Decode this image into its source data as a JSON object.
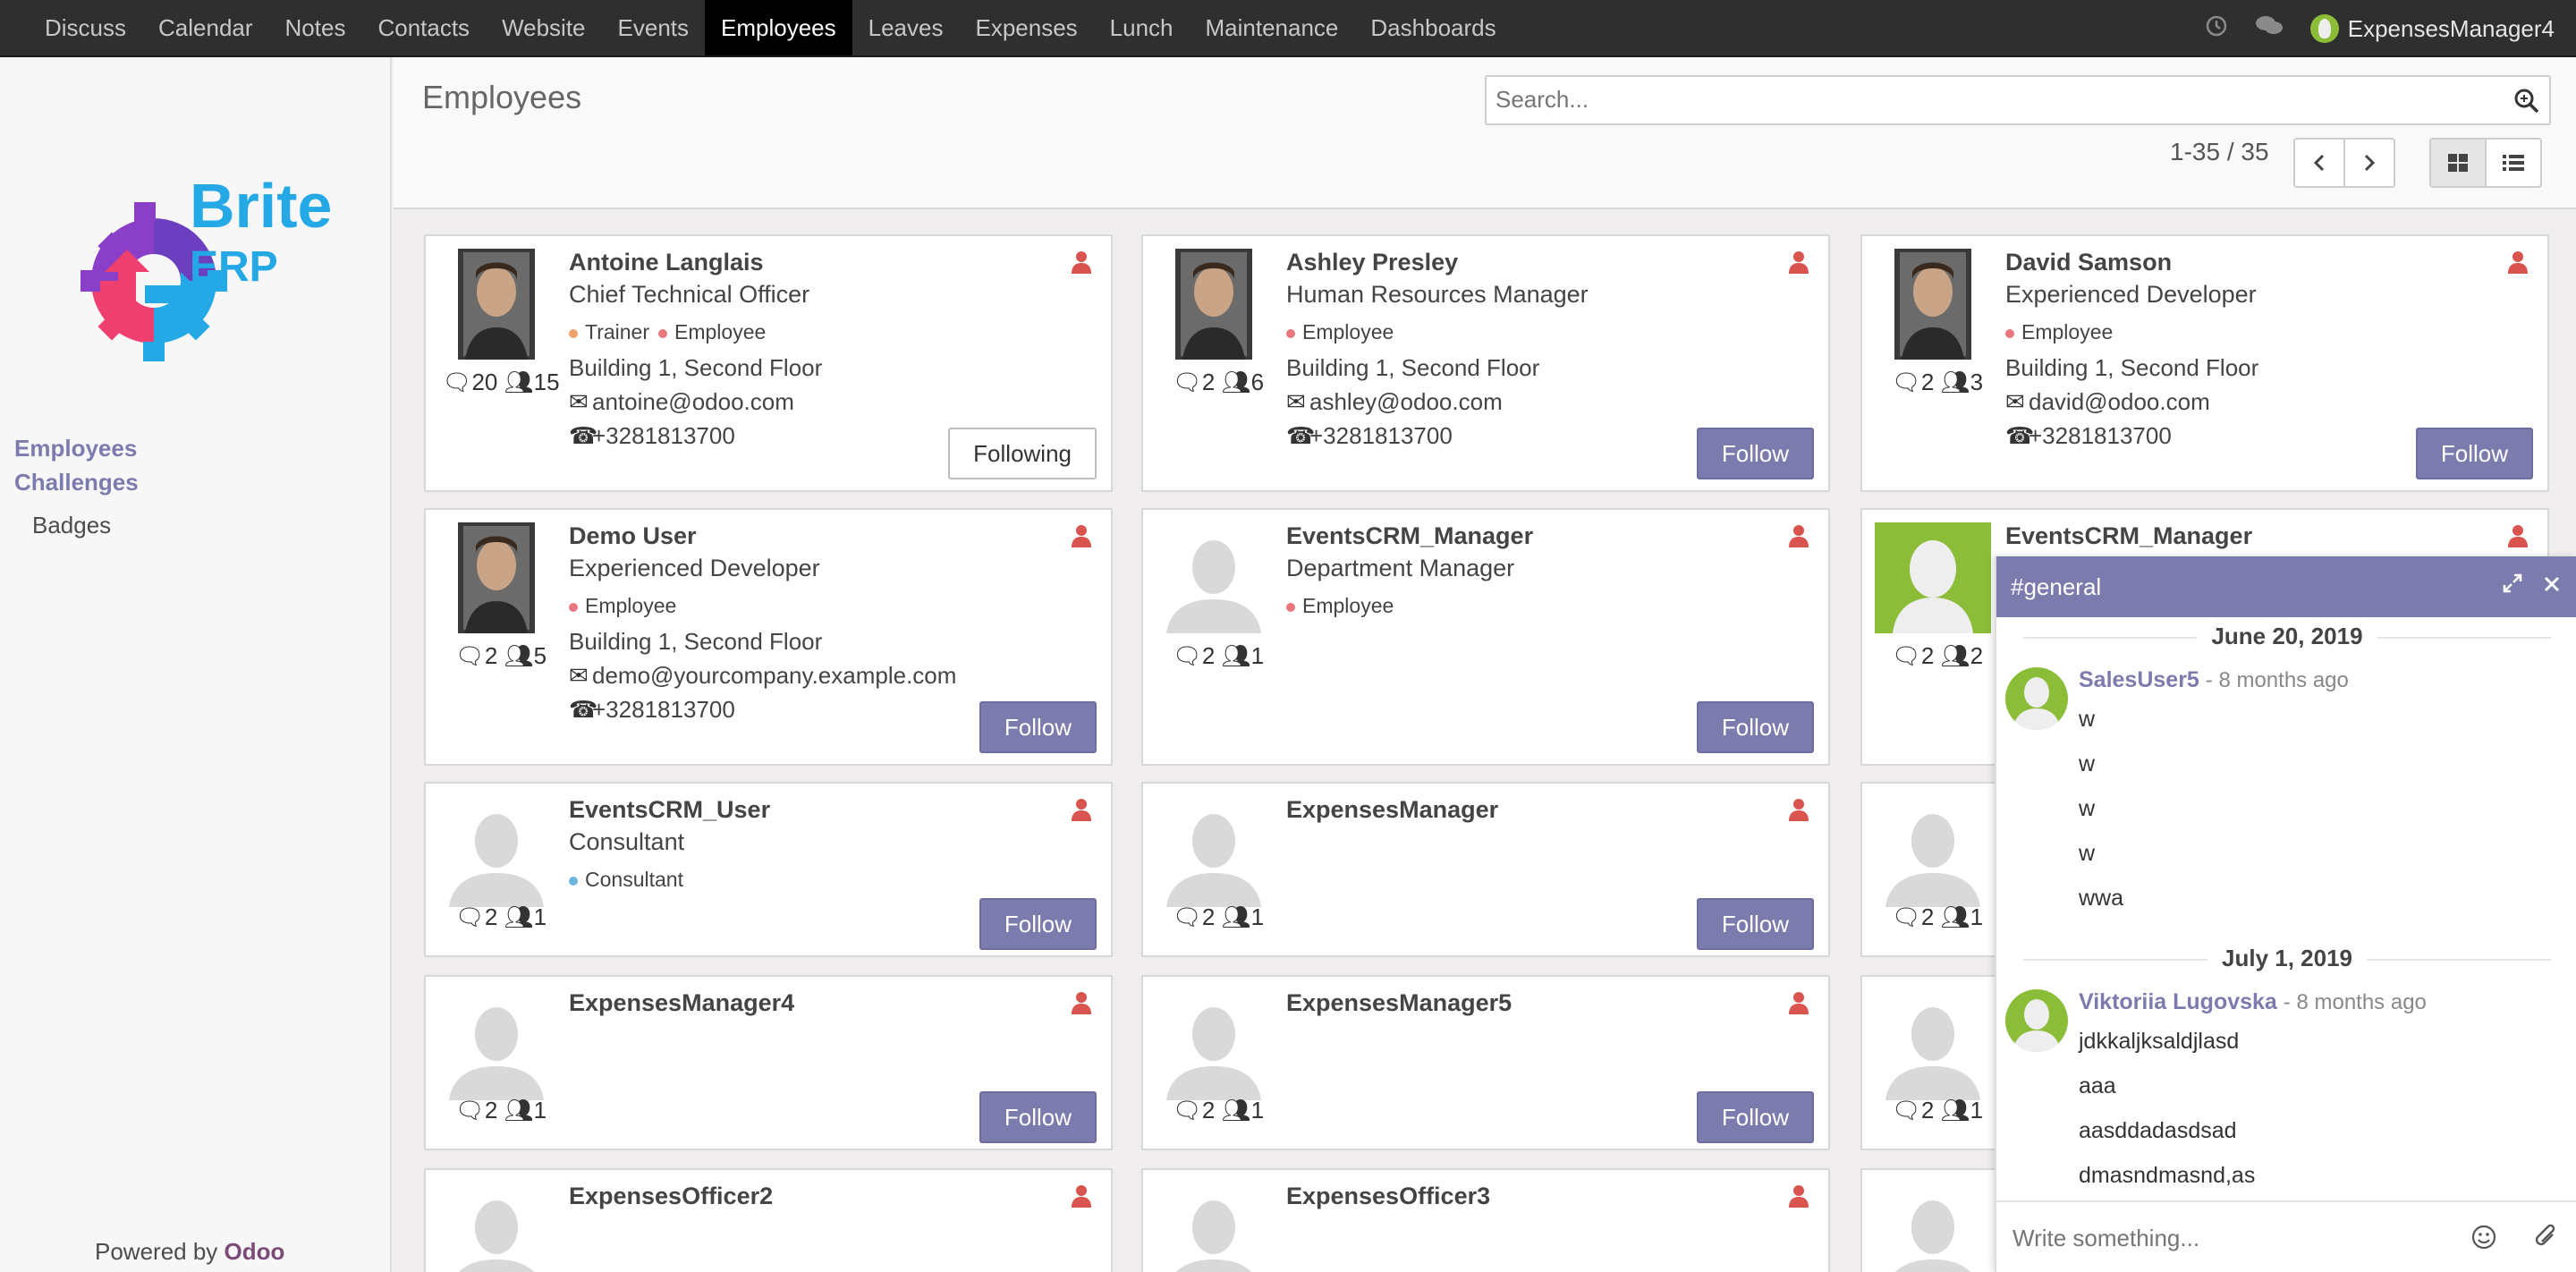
{
  "topbar": {
    "menu": [
      {
        "label": "Discuss",
        "active": false
      },
      {
        "label": "Calendar",
        "active": false
      },
      {
        "label": "Notes",
        "active": false
      },
      {
        "label": "Contacts",
        "active": false
      },
      {
        "label": "Website",
        "active": false
      },
      {
        "label": "Events",
        "active": false
      },
      {
        "label": "Employees",
        "active": true
      },
      {
        "label": "Leaves",
        "active": false
      },
      {
        "label": "Expenses",
        "active": false
      },
      {
        "label": "Lunch",
        "active": false
      },
      {
        "label": "Maintenance",
        "active": false
      },
      {
        "label": "Dashboards",
        "active": false
      }
    ],
    "user": "ExpensesManager4"
  },
  "sidebar": {
    "logo_text": "Brite ERP",
    "links": [
      "Employees",
      "Challenges"
    ],
    "sublinks": [
      "Badges"
    ],
    "powered_prefix": "Powered by",
    "powered_brand": "Odoo"
  },
  "control": {
    "title": "Employees",
    "search_placeholder": "Search...",
    "pager": "1-35 / 35"
  },
  "colors": {
    "accent": "#7c7bad",
    "topbar": "#2f2f2f",
    "danger_icon": "#d9534f"
  },
  "employees": [
    {
      "name": "Antoine Langlais",
      "job": "Chief Technical Officer",
      "tags": [
        {
          "label": "Trainer",
          "color": "orange"
        },
        {
          "label": "Employee",
          "color": "red"
        }
      ],
      "location": "Building 1, Second Floor",
      "email": "antoine@odoo.com",
      "phone": "+3281813700",
      "messages": "20",
      "followers": "15",
      "button": "Following",
      "photo": "photo"
    },
    {
      "name": "Ashley Presley",
      "job": "Human Resources Manager",
      "tags": [
        {
          "label": "Employee",
          "color": "red"
        }
      ],
      "location": "Building 1, Second Floor",
      "email": "ashley@odoo.com",
      "phone": "+3281813700",
      "messages": "2",
      "followers": "6",
      "button": "Follow",
      "photo": "photo"
    },
    {
      "name": "David Samson",
      "job": "Experienced Developer",
      "tags": [
        {
          "label": "Employee",
          "color": "red"
        }
      ],
      "location": "Building 1, Second Floor",
      "email": "david@odoo.com",
      "phone": "+3281813700",
      "messages": "2",
      "followers": "3",
      "button": "Follow",
      "photo": "photo"
    },
    {
      "name": "Demo User",
      "job": "Experienced Developer",
      "tags": [
        {
          "label": "Employee",
          "color": "red"
        }
      ],
      "location": "Building 1, Second Floor",
      "email": "demo@yourcompany.example.com",
      "phone": "+3281813700",
      "messages": "2",
      "followers": "5",
      "button": "Follow",
      "photo": "photo"
    },
    {
      "name": "EventsCRM_Manager",
      "job": "Department Manager",
      "tags": [
        {
          "label": "Employee",
          "color": "red"
        }
      ],
      "location": "",
      "email": "",
      "phone": "",
      "messages": "2",
      "followers": "1",
      "button": "Follow",
      "photo": "placeholder"
    },
    {
      "name": "EventsCRM_Manager",
      "job": "",
      "tags": [],
      "location": "",
      "email": "",
      "phone": "",
      "messages": "2",
      "followers": "2",
      "button": "",
      "photo": "green"
    },
    {
      "name": "EventsCRM_User",
      "job": "Consultant",
      "tags": [
        {
          "label": "Consultant",
          "color": "blue"
        }
      ],
      "location": "",
      "email": "",
      "phone": "",
      "messages": "2",
      "followers": "1",
      "button": "Follow",
      "photo": "placeholder"
    },
    {
      "name": "ExpensesManager",
      "job": "",
      "tags": [],
      "location": "",
      "email": "",
      "phone": "",
      "messages": "2",
      "followers": "1",
      "button": "Follow",
      "photo": "placeholder"
    },
    {
      "name": "",
      "job": "",
      "tags": [],
      "location": "",
      "email": "",
      "phone": "",
      "messages": "2",
      "followers": "1",
      "button": "",
      "photo": "placeholder"
    },
    {
      "name": "ExpensesManager4",
      "job": "",
      "tags": [],
      "location": "",
      "email": "",
      "phone": "",
      "messages": "2",
      "followers": "1",
      "button": "Follow",
      "photo": "placeholder"
    },
    {
      "name": "ExpensesManager5",
      "job": "",
      "tags": [],
      "location": "",
      "email": "",
      "phone": "",
      "messages": "2",
      "followers": "1",
      "button": "Follow",
      "photo": "placeholder"
    },
    {
      "name": "",
      "job": "",
      "tags": [],
      "location": "",
      "email": "",
      "phone": "",
      "messages": "2",
      "followers": "1",
      "button": "",
      "photo": "placeholder"
    },
    {
      "name": "ExpensesOfficer2",
      "job": "",
      "tags": [],
      "location": "",
      "email": "",
      "phone": "",
      "messages": "",
      "followers": "",
      "button": "",
      "photo": "placeholder"
    },
    {
      "name": "ExpensesOfficer3",
      "job": "",
      "tags": [],
      "location": "",
      "email": "",
      "phone": "",
      "messages": "",
      "followers": "",
      "button": "",
      "photo": "placeholder"
    },
    {
      "name": "",
      "job": "",
      "tags": [],
      "location": "",
      "email": "",
      "phone": "",
      "messages": "",
      "followers": "",
      "button": "",
      "photo": "placeholder"
    }
  ],
  "chat": {
    "channel": "#general",
    "groups": [
      {
        "date": "June 20, 2019",
        "author": "SalesUser5",
        "time": "- 8 months ago",
        "lines": [
          "w",
          "w",
          "w",
          "w",
          "wwa"
        ]
      },
      {
        "date": "July 1, 2019",
        "author": "Viktoriia Lugovska",
        "time": "- 8 months ago",
        "lines": [
          "jdkkaljksaldjlasd",
          "aaa",
          "aasddadasdsad",
          "dmasndmasnd,as"
        ]
      }
    ],
    "composer_placeholder": "Write something..."
  }
}
